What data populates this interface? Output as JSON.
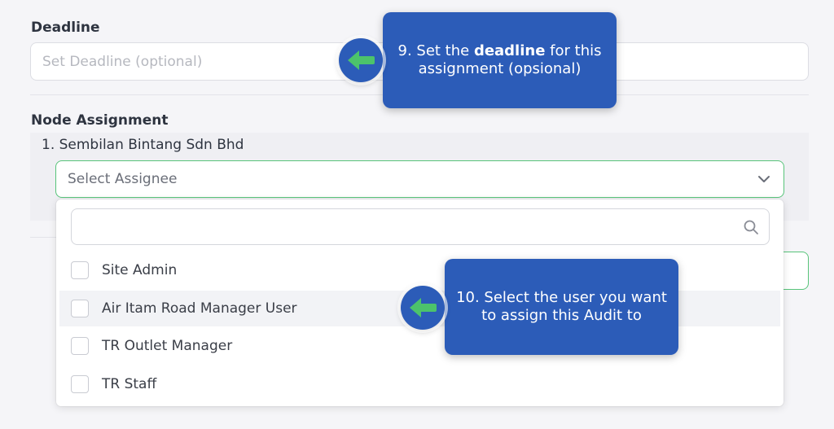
{
  "deadline": {
    "label": "Deadline",
    "placeholder": "Set Deadline (optional)",
    "value": ""
  },
  "node_assignment": {
    "label": "Node Assignment",
    "node_name": "1. Sembilan Bintang Sdn Bhd",
    "select_placeholder": "Select Assignee",
    "search_value": "",
    "options": [
      {
        "label": "Site Admin",
        "checked": false
      },
      {
        "label": "Air Itam Road Manager User",
        "checked": false,
        "highlighted": true
      },
      {
        "label": "TR Outlet Manager",
        "checked": false
      },
      {
        "label": "TR Staff",
        "checked": false
      }
    ]
  },
  "tips": {
    "tip9_prefix": "9. Set the ",
    "tip9_bold": "deadline",
    "tip9_suffix": " for this",
    "tip9_line2": "assignment (opsional)",
    "tip10_line1": "10. Select the user you want",
    "tip10_line2": "to assign this Audit to"
  },
  "colors": {
    "accent_green": "#58c47a",
    "tip_blue": "#2c5cb8",
    "arrow_green": "#4cc36b"
  },
  "icons": [
    "search-icon",
    "chevron-down-icon",
    "arrow-left-icon"
  ]
}
